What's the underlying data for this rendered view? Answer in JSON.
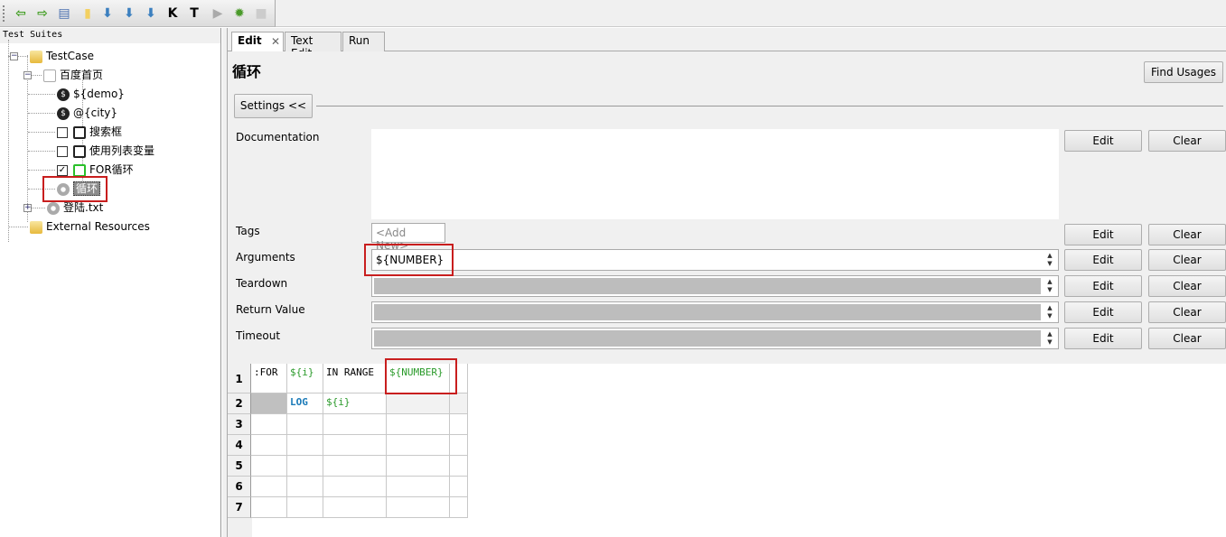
{
  "toolbar": {
    "items": [
      {
        "icon": "back-arrow-icon",
        "glyph": "⇦",
        "color": "#3a9a1a"
      },
      {
        "icon": "forward-arrow-icon",
        "glyph": "⇨",
        "color": "#3a9a1a"
      },
      {
        "icon": "open-folder-icon",
        "glyph": "▤",
        "color": "#4a70b0"
      },
      {
        "icon": "new-file-icon",
        "glyph": "▮",
        "color": "#f3d060"
      },
      {
        "icon": "save-icon",
        "glyph": "⬇",
        "color": "#3b7fbf"
      },
      {
        "icon": "save-all-icon",
        "glyph": "⬇",
        "color": "#3b7fbf"
      },
      {
        "icon": "save-as-icon",
        "glyph": "⬇",
        "color": "#3b7fbf"
      },
      {
        "icon": "search-keywords-icon",
        "glyph": "K",
        "color": "#000"
      },
      {
        "icon": "search-tests-icon",
        "glyph": "T",
        "color": "#000"
      },
      {
        "icon": "run-icon",
        "glyph": "▶",
        "color": "#aaa"
      },
      {
        "icon": "debug-bug-icon",
        "glyph": "✹",
        "color": "#4a9a2a"
      },
      {
        "icon": "stop-icon",
        "glyph": "■",
        "color": "#ccc"
      }
    ]
  },
  "tree": {
    "header": "Test Suites",
    "nodes": [
      {
        "label": "TestCase"
      },
      {
        "label": "百度首页"
      },
      {
        "label": "${demo}"
      },
      {
        "label": "@{city}"
      },
      {
        "label": "搜索框",
        "checked": false
      },
      {
        "label": "使用列表变量",
        "checked": false
      },
      {
        "label": "FOR循环",
        "checked": true
      },
      {
        "label": "循环",
        "selected": true
      },
      {
        "label": "登陆.txt"
      },
      {
        "label": "External Resources"
      }
    ]
  },
  "tabs": [
    {
      "label": "Edit",
      "active": true
    },
    {
      "label": "Text Edit"
    },
    {
      "label": "Run"
    }
  ],
  "editor": {
    "title": "循环",
    "find_usages": "Find Usages",
    "settings_toggle": "Settings <<",
    "edit_label": "Edit",
    "clear_label": "Clear",
    "documentation": {
      "label": "Documentation",
      "value": ""
    },
    "tags": {
      "label": "Tags",
      "placeholder": "<Add New>"
    },
    "arguments": {
      "label": "Arguments",
      "value": "${NUMBER}"
    },
    "teardown": {
      "label": "Teardown",
      "value": ""
    },
    "return_value": {
      "label": "Return Value",
      "value": ""
    },
    "timeout": {
      "label": "Timeout",
      "value": ""
    }
  },
  "grid": {
    "row_numbers": [
      "1",
      "2",
      "3",
      "4",
      "5",
      "6",
      "7"
    ],
    "rows": [
      [
        ":FOR",
        "${i}",
        "IN RANGE",
        "${NUMBER}",
        ""
      ],
      [
        "",
        "LOG",
        "${i}",
        "",
        ""
      ],
      [
        "",
        "",
        "",
        "",
        ""
      ],
      [
        "",
        "",
        "",
        "",
        ""
      ],
      [
        "",
        "",
        "",
        "",
        ""
      ],
      [
        "",
        "",
        "",
        "",
        ""
      ],
      [
        "",
        "",
        "",
        "",
        ""
      ]
    ]
  }
}
